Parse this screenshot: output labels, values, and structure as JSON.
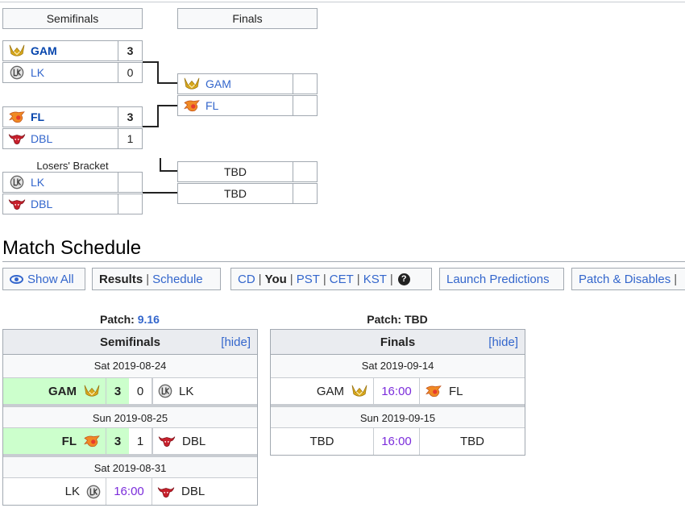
{
  "bracket": {
    "semifinals_label": "Semifinals",
    "finals_label": "Finals",
    "losers_label": "Losers' Bracket",
    "semi1": [
      {
        "team": "GAM",
        "score": "3",
        "winner": true,
        "icon": "gam-logo-icon"
      },
      {
        "team": "LK",
        "score": "0",
        "winner": false,
        "icon": "lk-logo-icon"
      }
    ],
    "semi2": [
      {
        "team": "FL",
        "score": "3",
        "winner": true,
        "icon": "fl-logo-icon"
      },
      {
        "team": "DBL",
        "score": "1",
        "winner": false,
        "icon": "dbl-logo-icon"
      }
    ],
    "losers": [
      {
        "team": "LK",
        "score": "",
        "icon": "lk-logo-icon"
      },
      {
        "team": "DBL",
        "score": "",
        "icon": "dbl-logo-icon"
      }
    ],
    "final": [
      {
        "team": "GAM",
        "score": "",
        "icon": "gam-logo-icon"
      },
      {
        "team": "FL",
        "score": "",
        "icon": "fl-logo-icon"
      }
    ],
    "third": [
      {
        "team": "TBD",
        "score": ""
      },
      {
        "team": "TBD",
        "score": ""
      }
    ]
  },
  "schedule": {
    "title": "Match Schedule",
    "toolbar": {
      "show_all": "Show All",
      "results": "Results",
      "schedule": "Schedule",
      "tz_cd": "CD",
      "tz_you": "You",
      "tz_pst": "PST",
      "tz_cet": "CET",
      "tz_kst": "KST",
      "help": "?",
      "launch_predictions": "Launch Predictions",
      "patch_disables": "Patch & Disables"
    },
    "sep": "|",
    "patch_prefix": "Patch: ",
    "semifinals": {
      "patch": "9.16",
      "title": "Semifinals",
      "hide": "[hide]",
      "days": [
        {
          "date": "Sat 2019-08-24",
          "t1": "GAM",
          "s1": "3",
          "s2": "0",
          "t2": "LK",
          "winner": 1
        },
        {
          "date": "Sun 2019-08-25",
          "t1": "FL",
          "s1": "3",
          "s2": "1",
          "t2": "DBL",
          "winner": 1
        },
        {
          "date": "Sat 2019-08-31",
          "t1": "LK",
          "time": "16:00",
          "t2": "DBL",
          "winner": 0
        }
      ]
    },
    "finals": {
      "patch": "TBD",
      "title": "Finals",
      "hide": "[hide]",
      "days": [
        {
          "date": "Sat 2019-09-14",
          "t1": "GAM",
          "time": "16:00",
          "t2": "FL"
        },
        {
          "date": "Sun 2019-09-15",
          "t1": "TBD",
          "time": "16:00",
          "t2": "TBD"
        }
      ]
    }
  },
  "colors": {
    "link": "#3366cc",
    "winner_bg": "#ccffcc",
    "time": "#7b2cdb",
    "border": "#a2a9b1"
  }
}
